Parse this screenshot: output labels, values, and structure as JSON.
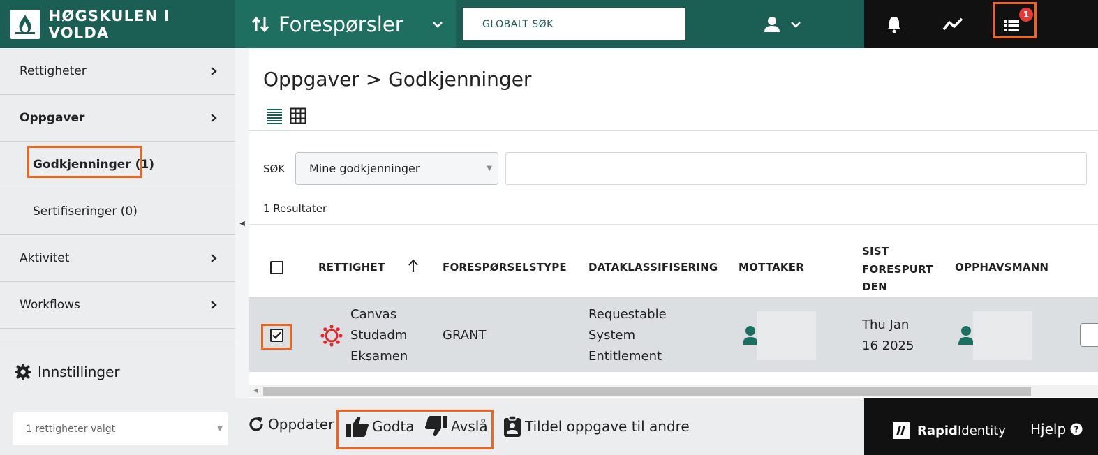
{
  "header": {
    "brand_name": "HØGSKULEN I VOLDA",
    "module_name": "Forespørsler",
    "global_search_label": "GLOBALT SØK",
    "notification_count": "1"
  },
  "sidebar": {
    "items": [
      {
        "label": "Rettigheter"
      },
      {
        "label": "Oppgaver"
      },
      {
        "label": "Godkjenninger (1)"
      },
      {
        "label": "Sertifiseringer (0)"
      },
      {
        "label": "Aktivitet"
      },
      {
        "label": "Workflows"
      }
    ],
    "settings_label": "Innstillinger"
  },
  "main": {
    "title": "Oppgaver > Godkjenninger",
    "search_label": "SØK",
    "search_select_value": "Mine godkjenninger",
    "results_text": "1 Resultater",
    "columns": {
      "rettighet": "RETTIGHET",
      "foresporselstype": "FORESPØRSELSTYPE",
      "dataklassifisering": "DATAKLASSIFISERING",
      "mottaker": "MOTTAKER",
      "sist_1": "SIST",
      "sist_2": "FORESPURT",
      "sist_3": "DEN",
      "opphavsmann": "OPPHAVSMANN"
    },
    "row": {
      "rettighet_1": "Canvas",
      "rettighet_2": "Studadm",
      "rettighet_3": "Eksamen",
      "type": "GRANT",
      "class_1": "Requestable",
      "class_2": "System",
      "class_3": "Entitlement",
      "date_1": "Thu Jan",
      "date_2": "16 2025"
    }
  },
  "bottom": {
    "bulk_select": "1 rettigheter valgt",
    "refresh": "Oppdater",
    "approve": "Godta",
    "deny": "Avslå",
    "assign": "Tildel oppgave til andre",
    "brand_rapid": "Rapid",
    "brand_identity": "Identity",
    "help": "Hjelp"
  },
  "colors": {
    "brand_teal": "#1b5e53",
    "highlight": "#f0641e"
  }
}
